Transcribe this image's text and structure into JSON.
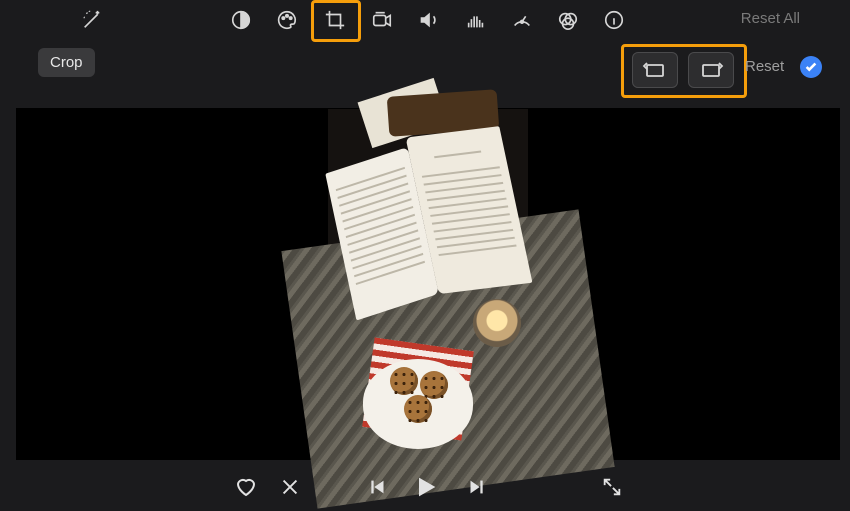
{
  "toolbar": {
    "reset_all_label": "Reset All"
  },
  "subbar": {
    "crop_label": "Crop",
    "reset_label": "Reset"
  }
}
